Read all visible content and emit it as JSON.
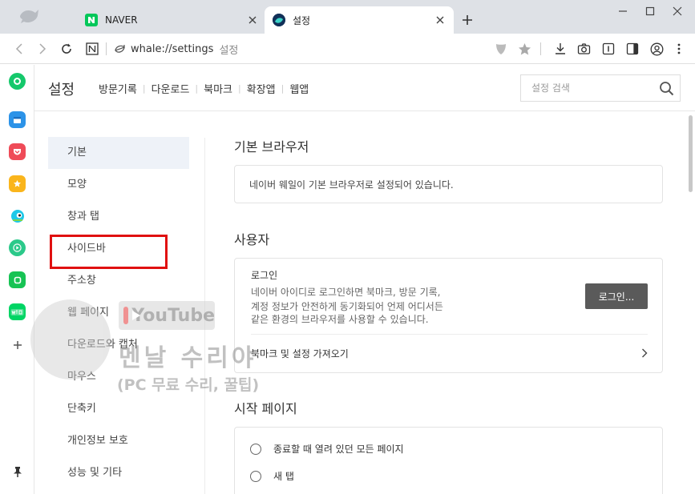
{
  "tabs": [
    {
      "title": "NAVER",
      "favicon": "naver-n-icon",
      "color": "#03c75a",
      "active": false
    },
    {
      "title": "설정",
      "favicon": "whale-icon",
      "color": "#1a3b66",
      "active": true
    }
  ],
  "address": {
    "url": "whale://settings",
    "suffix": "설정"
  },
  "header": {
    "title": "설정",
    "nav": [
      "방문기록",
      "다운로드",
      "북마크",
      "확장앱",
      "웹앱"
    ],
    "search_placeholder": "설정 검색"
  },
  "left_nav": {
    "items": [
      "기본",
      "모양",
      "창과 탭",
      "사이드바",
      "주소창",
      "웹 페이지",
      "다운로드와 캡처",
      "마우스",
      "단축키",
      "개인정보 보호",
      "성능 및 기타"
    ],
    "active_index": 0,
    "highlighted_index": 3
  },
  "sections": {
    "default_browser": {
      "title": "기본 브라우저",
      "text": "네이버 웨일이 기본 브라우저로 설정되어 있습니다."
    },
    "user": {
      "title": "사용자",
      "login_heading": "로그인",
      "login_desc_1": "네이버 아이디로 로그인하면 북마크, 방문 기록,",
      "login_desc_2": "계정 정보가 안전하게 동기화되어 언제 어디서든",
      "login_desc_3": "같은 환경의 브라우저를 사용할 수 있습니다.",
      "login_button": "로그인...",
      "import_label": "북마크 및 설정 가져오기"
    },
    "start_page": {
      "title": "시작 페이지",
      "options": [
        "종료할 때 열려 있던 모든 페이지",
        "새 탭"
      ]
    }
  },
  "watermark": {
    "brand": "YouTube",
    "title": "멘날 수리야",
    "subtitle": "(PC 무료 수리, 꿀팁)"
  },
  "colors": {
    "tabbar_bg": "#dee1e6",
    "active_nav_bg": "#eef2f8",
    "highlight_border": "#e01010",
    "login_button_bg": "#5a5a5a"
  }
}
